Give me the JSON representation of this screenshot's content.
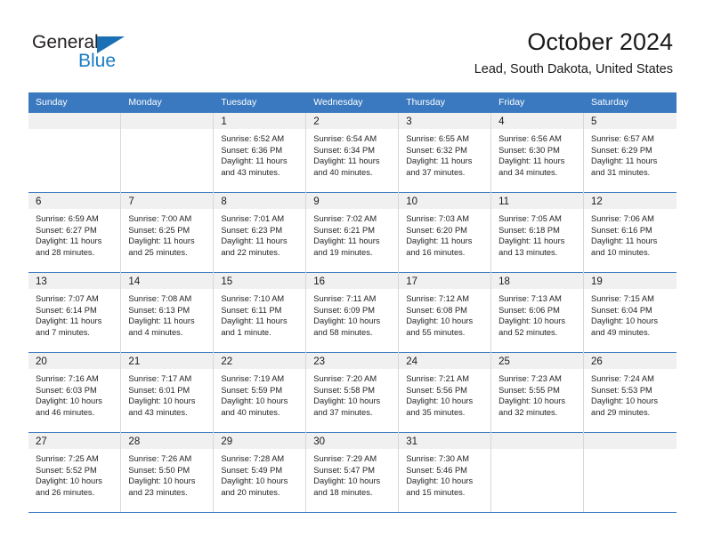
{
  "logo": {
    "text_top": "General",
    "text_bottom": "Blue",
    "triangle_icon": "blue-triangle-icon",
    "color_dark": "#231f20",
    "color_blue": "#1a7cc4"
  },
  "header": {
    "title": "October 2024",
    "subtitle": "Lead, South Dakota, United States"
  },
  "theme": {
    "header_blue": "#3a79bf",
    "daynum_band": "#f0f0f0",
    "text": "#231f20"
  },
  "weekdays": [
    "Sunday",
    "Monday",
    "Tuesday",
    "Wednesday",
    "Thursday",
    "Friday",
    "Saturday"
  ],
  "weeks": [
    [
      {
        "day": "",
        "sunrise": "",
        "sunset": "",
        "daylight_1": "",
        "daylight_2": ""
      },
      {
        "day": "",
        "sunrise": "",
        "sunset": "",
        "daylight_1": "",
        "daylight_2": ""
      },
      {
        "day": "1",
        "sunrise": "Sunrise: 6:52 AM",
        "sunset": "Sunset: 6:36 PM",
        "daylight_1": "Daylight: 11 hours",
        "daylight_2": "and 43 minutes."
      },
      {
        "day": "2",
        "sunrise": "Sunrise: 6:54 AM",
        "sunset": "Sunset: 6:34 PM",
        "daylight_1": "Daylight: 11 hours",
        "daylight_2": "and 40 minutes."
      },
      {
        "day": "3",
        "sunrise": "Sunrise: 6:55 AM",
        "sunset": "Sunset: 6:32 PM",
        "daylight_1": "Daylight: 11 hours",
        "daylight_2": "and 37 minutes."
      },
      {
        "day": "4",
        "sunrise": "Sunrise: 6:56 AM",
        "sunset": "Sunset: 6:30 PM",
        "daylight_1": "Daylight: 11 hours",
        "daylight_2": "and 34 minutes."
      },
      {
        "day": "5",
        "sunrise": "Sunrise: 6:57 AM",
        "sunset": "Sunset: 6:29 PM",
        "daylight_1": "Daylight: 11 hours",
        "daylight_2": "and 31 minutes."
      }
    ],
    [
      {
        "day": "6",
        "sunrise": "Sunrise: 6:59 AM",
        "sunset": "Sunset: 6:27 PM",
        "daylight_1": "Daylight: 11 hours",
        "daylight_2": "and 28 minutes."
      },
      {
        "day": "7",
        "sunrise": "Sunrise: 7:00 AM",
        "sunset": "Sunset: 6:25 PM",
        "daylight_1": "Daylight: 11 hours",
        "daylight_2": "and 25 minutes."
      },
      {
        "day": "8",
        "sunrise": "Sunrise: 7:01 AM",
        "sunset": "Sunset: 6:23 PM",
        "daylight_1": "Daylight: 11 hours",
        "daylight_2": "and 22 minutes."
      },
      {
        "day": "9",
        "sunrise": "Sunrise: 7:02 AM",
        "sunset": "Sunset: 6:21 PM",
        "daylight_1": "Daylight: 11 hours",
        "daylight_2": "and 19 minutes."
      },
      {
        "day": "10",
        "sunrise": "Sunrise: 7:03 AM",
        "sunset": "Sunset: 6:20 PM",
        "daylight_1": "Daylight: 11 hours",
        "daylight_2": "and 16 minutes."
      },
      {
        "day": "11",
        "sunrise": "Sunrise: 7:05 AM",
        "sunset": "Sunset: 6:18 PM",
        "daylight_1": "Daylight: 11 hours",
        "daylight_2": "and 13 minutes."
      },
      {
        "day": "12",
        "sunrise": "Sunrise: 7:06 AM",
        "sunset": "Sunset: 6:16 PM",
        "daylight_1": "Daylight: 11 hours",
        "daylight_2": "and 10 minutes."
      }
    ],
    [
      {
        "day": "13",
        "sunrise": "Sunrise: 7:07 AM",
        "sunset": "Sunset: 6:14 PM",
        "daylight_1": "Daylight: 11 hours",
        "daylight_2": "and 7 minutes."
      },
      {
        "day": "14",
        "sunrise": "Sunrise: 7:08 AM",
        "sunset": "Sunset: 6:13 PM",
        "daylight_1": "Daylight: 11 hours",
        "daylight_2": "and 4 minutes."
      },
      {
        "day": "15",
        "sunrise": "Sunrise: 7:10 AM",
        "sunset": "Sunset: 6:11 PM",
        "daylight_1": "Daylight: 11 hours",
        "daylight_2": "and 1 minute."
      },
      {
        "day": "16",
        "sunrise": "Sunrise: 7:11 AM",
        "sunset": "Sunset: 6:09 PM",
        "daylight_1": "Daylight: 10 hours",
        "daylight_2": "and 58 minutes."
      },
      {
        "day": "17",
        "sunrise": "Sunrise: 7:12 AM",
        "sunset": "Sunset: 6:08 PM",
        "daylight_1": "Daylight: 10 hours",
        "daylight_2": "and 55 minutes."
      },
      {
        "day": "18",
        "sunrise": "Sunrise: 7:13 AM",
        "sunset": "Sunset: 6:06 PM",
        "daylight_1": "Daylight: 10 hours",
        "daylight_2": "and 52 minutes."
      },
      {
        "day": "19",
        "sunrise": "Sunrise: 7:15 AM",
        "sunset": "Sunset: 6:04 PM",
        "daylight_1": "Daylight: 10 hours",
        "daylight_2": "and 49 minutes."
      }
    ],
    [
      {
        "day": "20",
        "sunrise": "Sunrise: 7:16 AM",
        "sunset": "Sunset: 6:03 PM",
        "daylight_1": "Daylight: 10 hours",
        "daylight_2": "and 46 minutes."
      },
      {
        "day": "21",
        "sunrise": "Sunrise: 7:17 AM",
        "sunset": "Sunset: 6:01 PM",
        "daylight_1": "Daylight: 10 hours",
        "daylight_2": "and 43 minutes."
      },
      {
        "day": "22",
        "sunrise": "Sunrise: 7:19 AM",
        "sunset": "Sunset: 5:59 PM",
        "daylight_1": "Daylight: 10 hours",
        "daylight_2": "and 40 minutes."
      },
      {
        "day": "23",
        "sunrise": "Sunrise: 7:20 AM",
        "sunset": "Sunset: 5:58 PM",
        "daylight_1": "Daylight: 10 hours",
        "daylight_2": "and 37 minutes."
      },
      {
        "day": "24",
        "sunrise": "Sunrise: 7:21 AM",
        "sunset": "Sunset: 5:56 PM",
        "daylight_1": "Daylight: 10 hours",
        "daylight_2": "and 35 minutes."
      },
      {
        "day": "25",
        "sunrise": "Sunrise: 7:23 AM",
        "sunset": "Sunset: 5:55 PM",
        "daylight_1": "Daylight: 10 hours",
        "daylight_2": "and 32 minutes."
      },
      {
        "day": "26",
        "sunrise": "Sunrise: 7:24 AM",
        "sunset": "Sunset: 5:53 PM",
        "daylight_1": "Daylight: 10 hours",
        "daylight_2": "and 29 minutes."
      }
    ],
    [
      {
        "day": "27",
        "sunrise": "Sunrise: 7:25 AM",
        "sunset": "Sunset: 5:52 PM",
        "daylight_1": "Daylight: 10 hours",
        "daylight_2": "and 26 minutes."
      },
      {
        "day": "28",
        "sunrise": "Sunrise: 7:26 AM",
        "sunset": "Sunset: 5:50 PM",
        "daylight_1": "Daylight: 10 hours",
        "daylight_2": "and 23 minutes."
      },
      {
        "day": "29",
        "sunrise": "Sunrise: 7:28 AM",
        "sunset": "Sunset: 5:49 PM",
        "daylight_1": "Daylight: 10 hours",
        "daylight_2": "and 20 minutes."
      },
      {
        "day": "30",
        "sunrise": "Sunrise: 7:29 AM",
        "sunset": "Sunset: 5:47 PM",
        "daylight_1": "Daylight: 10 hours",
        "daylight_2": "and 18 minutes."
      },
      {
        "day": "31",
        "sunrise": "Sunrise: 7:30 AM",
        "sunset": "Sunset: 5:46 PM",
        "daylight_1": "Daylight: 10 hours",
        "daylight_2": "and 15 minutes."
      },
      {
        "day": "",
        "sunrise": "",
        "sunset": "",
        "daylight_1": "",
        "daylight_2": ""
      },
      {
        "day": "",
        "sunrise": "",
        "sunset": "",
        "daylight_1": "",
        "daylight_2": ""
      }
    ]
  ]
}
